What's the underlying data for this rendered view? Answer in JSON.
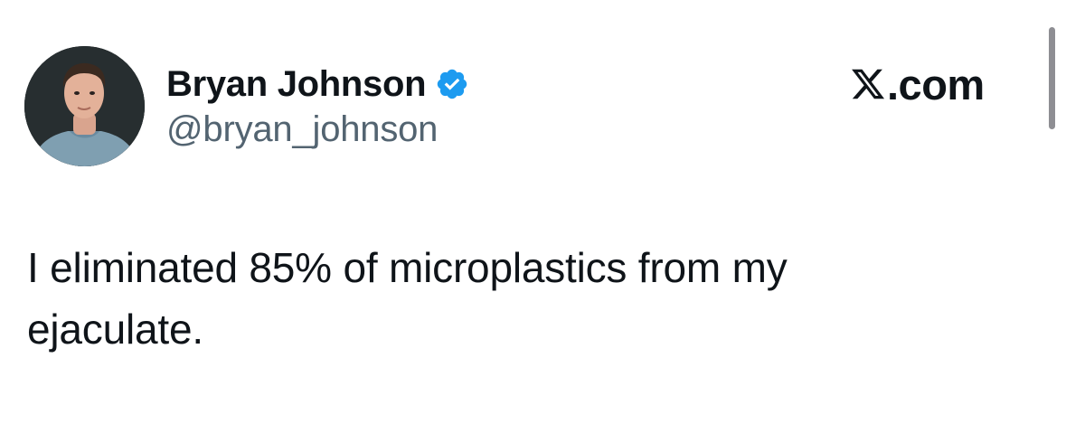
{
  "author": {
    "name": "Bryan Johnson",
    "handle": "@bryan_johnson",
    "avatar_icon": "profile-photo",
    "verified_icon": "verified-badge-icon",
    "verified_color": "#1d9bf0"
  },
  "brand": {
    "logo_icon": "x-logo-icon",
    "domain": ".com"
  },
  "tweet": {
    "text": "I eliminated 85% of microplastics from my\nejaculate."
  },
  "colors": {
    "text_primary": "#0f1419",
    "text_secondary": "#536471",
    "background": "#ffffff"
  }
}
